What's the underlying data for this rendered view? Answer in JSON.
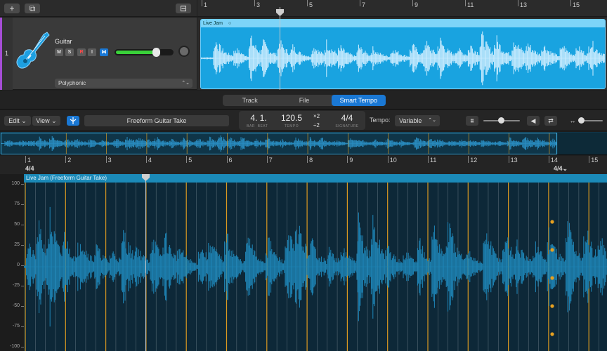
{
  "toolbar_top": {
    "add_label": "+",
    "duplicate_label": "⧉",
    "tracks_label": "⊟"
  },
  "track": {
    "number": "1",
    "name": "Guitar",
    "mute": "M",
    "solo": "S",
    "record": "R",
    "input": "I",
    "freeze": "⋈",
    "mode": "Polyphonic",
    "volume_fraction": 0.72,
    "colors": {
      "track_color": "#a64dd6",
      "region": "#19a3e0",
      "icon": "#1d9fe0"
    }
  },
  "top_ruler": {
    "bars": [
      "1",
      "3",
      "5",
      "7",
      "9",
      "11",
      "13",
      "15"
    ]
  },
  "top_region": {
    "title": "Live Jam",
    "loop_icon": "○"
  },
  "tabs": [
    {
      "label": "Track",
      "active": false
    },
    {
      "label": "File",
      "active": false
    },
    {
      "label": "Smart Tempo",
      "active": true
    }
  ],
  "editor_toolbar": {
    "edit": "Edit",
    "view": "View",
    "chev": "⌄",
    "take_name": "Freeform Guitar Take",
    "position": "4. 1.",
    "position_label_bar": "BAR",
    "position_label_beat": "BEAT",
    "tempo": "120.5",
    "tempo_label": "TEMPO",
    "times2": "×2",
    "div2": "÷2",
    "signature": "4/4",
    "signature_label": "SIGNATURE",
    "tempo_field_label": "Tempo:",
    "tempo_mode": "Variable",
    "select_chev": "⌃⌄",
    "flex_icon": "⩩",
    "speaker_icon": "◀",
    "loop_icon": "⇄",
    "zoom_icon": "↔"
  },
  "lower_ruler": {
    "bars": [
      "1",
      "2",
      "3",
      "4",
      "5",
      "6",
      "7",
      "8",
      "9",
      "10",
      "11",
      "12",
      "13",
      "14",
      "15"
    ],
    "ts_left": "4/4",
    "ts_right": "4/4⌄"
  },
  "lower_region": {
    "title": "Live Jam (Freeform Guitar Take)"
  },
  "amplitude_axis": [
    "100",
    "75",
    "50",
    "25",
    "0",
    "-25",
    "-50",
    "-75",
    "-100"
  ],
  "colors": {
    "beat_marker": "#e6a020",
    "waveform_lower": "#1e86b8",
    "waveform_top": "#cfeeff",
    "accent_blue": "#1a78d4"
  }
}
